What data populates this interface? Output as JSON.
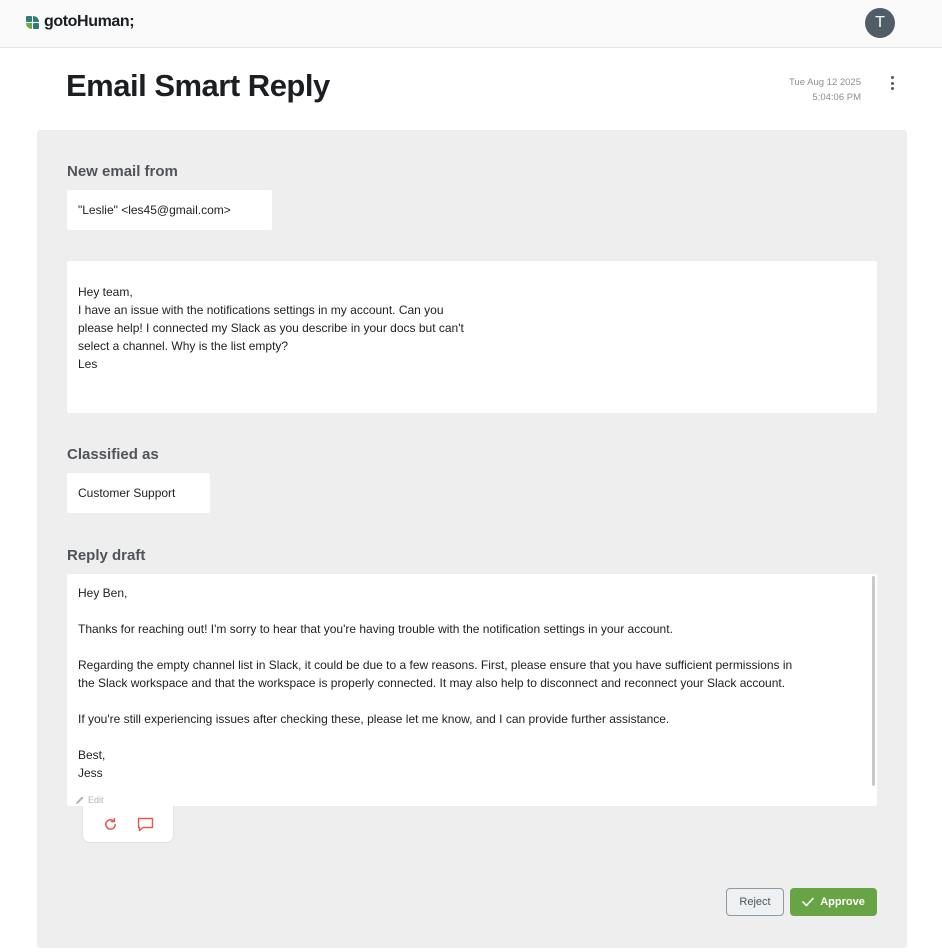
{
  "app": {
    "brand": "gotoHuman;",
    "user_initial": "T"
  },
  "header": {
    "title": "Email Smart Reply",
    "date": "Tue Aug 12 2025",
    "time": "5:04:06 PM"
  },
  "fields": {
    "sender_label": "New email from",
    "sender_value": "\"Leslie\" <les45@gmail.com>",
    "email_lines": [
      "Hey team,",
      "I have an issue with the notifications settings in my account. Can you",
      "please help! I connected my Slack as you describe in your docs but can't",
      "select a channel. Why is the list empty?",
      "Les"
    ],
    "classified_label": "Classified as",
    "classified_value": "Customer Support",
    "reply_label": "Reply draft",
    "reply_lines": [
      "Hey Ben,",
      "",
      "Thanks for reaching out! I'm sorry to hear that you're having trouble with the notification settings in your account.",
      "",
      "Regarding the empty channel list in Slack, it could be due to a few reasons. First, please ensure that you have sufficient permissions in",
      "the Slack workspace and that the workspace is properly connected. It may also help to disconnect and reconnect your Slack account.",
      "",
      "If you're still experiencing issues after checking these, please let me know, and I can provide further assistance.",
      "",
      "Best,",
      "Jess"
    ],
    "edit_label": "Edit"
  },
  "buttons": {
    "reject": "Reject",
    "approve": "Approve"
  },
  "colors": {
    "approve": "#67a443",
    "regenerate_icon": "#e05a4f",
    "logo_teal": "#2f7d78",
    "logo_green": "#6aab45"
  },
  "icons": [
    "logo-icon",
    "more-vertical-icon",
    "pencil-icon",
    "refresh-icon",
    "comment-icon",
    "check-icon"
  ]
}
